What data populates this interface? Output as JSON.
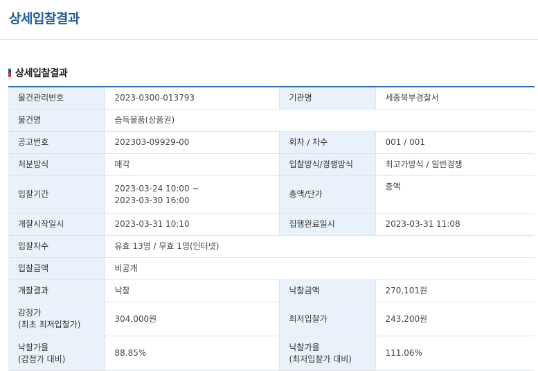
{
  "page": {
    "title": "상세입찰결과"
  },
  "section": {
    "title": "상세입찰결과"
  },
  "rows": [
    {
      "l1": "물건관리번호",
      "v1": "2023-0300-013793",
      "l2": "기관명",
      "v2": "세종북부경찰서"
    },
    {
      "l1": "물건명",
      "v1": "습득물품(상품권)"
    },
    {
      "l1": "공고번호",
      "v1": "202303-09929-00",
      "l2": "회차 / 차수",
      "v2": "001 / 001"
    },
    {
      "l1": "처분방식",
      "v1": "매각",
      "l2": "입찰방식/경쟁방식",
      "v2": "최고가방식 / 일반경쟁"
    },
    {
      "l1": "입찰기간",
      "v1a": "2023-03-24 10:00 ~",
      "v1b": "2023-03-30 16:00",
      "l2": "총액/단가",
      "v2": "총액"
    },
    {
      "l1": "개찰시작일시",
      "v1": "2023-03-31 10:10",
      "l2": "집행완료일시",
      "v2": "2023-03-31 11:08"
    },
    {
      "l1": "입찰자수",
      "v1": "유효 13명 / 무효 1명(인터넷)"
    },
    {
      "l1": "입찰금액",
      "v1": "비공개"
    },
    {
      "l1": "개찰결과",
      "v1": "낙찰",
      "l2": "낙찰금액",
      "v2": "270,101원"
    },
    {
      "l1a": "감정가",
      "l1b": "(최초 최저입찰가)",
      "v1": "304,000원",
      "l2": "최저입찰가",
      "v2": "243,200원"
    },
    {
      "l1a": "낙찰가율",
      "l1b": "(감정가 대비)",
      "v1": "88.85%",
      "l2a": "낙찰가율",
      "l2b": "(최저입찰가 대비)",
      "v2": "111.06%"
    }
  ]
}
